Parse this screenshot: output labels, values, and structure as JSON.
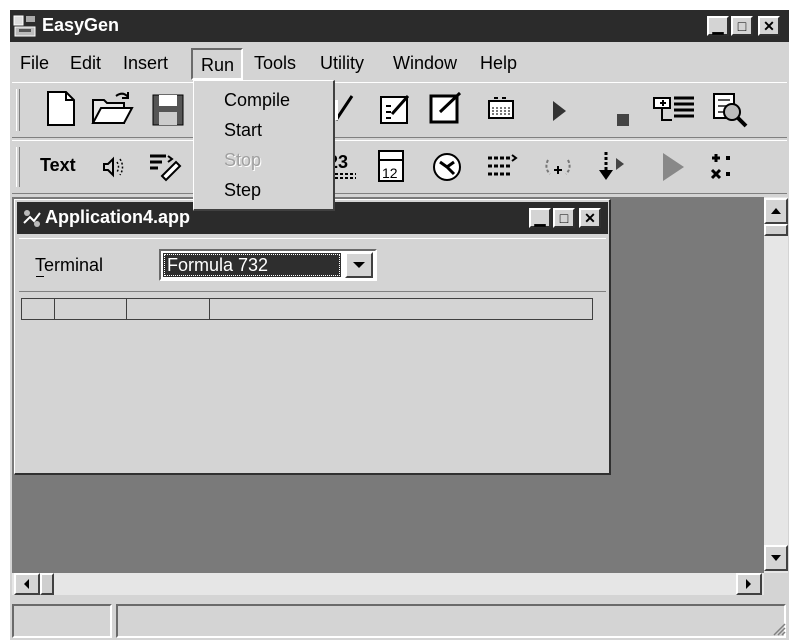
{
  "app": {
    "title": "EasyGen"
  },
  "menubar": {
    "items": [
      {
        "label": "File"
      },
      {
        "label": "Edit"
      },
      {
        "label": "Insert"
      },
      {
        "label": "Run"
      },
      {
        "label": "Tools"
      },
      {
        "label": "Utility"
      },
      {
        "label": "Window"
      },
      {
        "label": "Help"
      }
    ]
  },
  "run_menu": {
    "items": [
      {
        "label": "Compile",
        "enabled": true
      },
      {
        "label": "Start",
        "enabled": true
      },
      {
        "label": "Stop",
        "enabled": false
      },
      {
        "label": "Step",
        "enabled": true
      }
    ]
  },
  "toolbar2": {
    "text_label": "Text"
  },
  "child_window": {
    "title": "Application4.app",
    "terminal_label": "Terminal",
    "terminal_value": "Formula 732"
  },
  "colors": {
    "titlebar": "#2b2b2b",
    "mdi_background": "#7a7a7a",
    "face": "#d4d4d4"
  }
}
